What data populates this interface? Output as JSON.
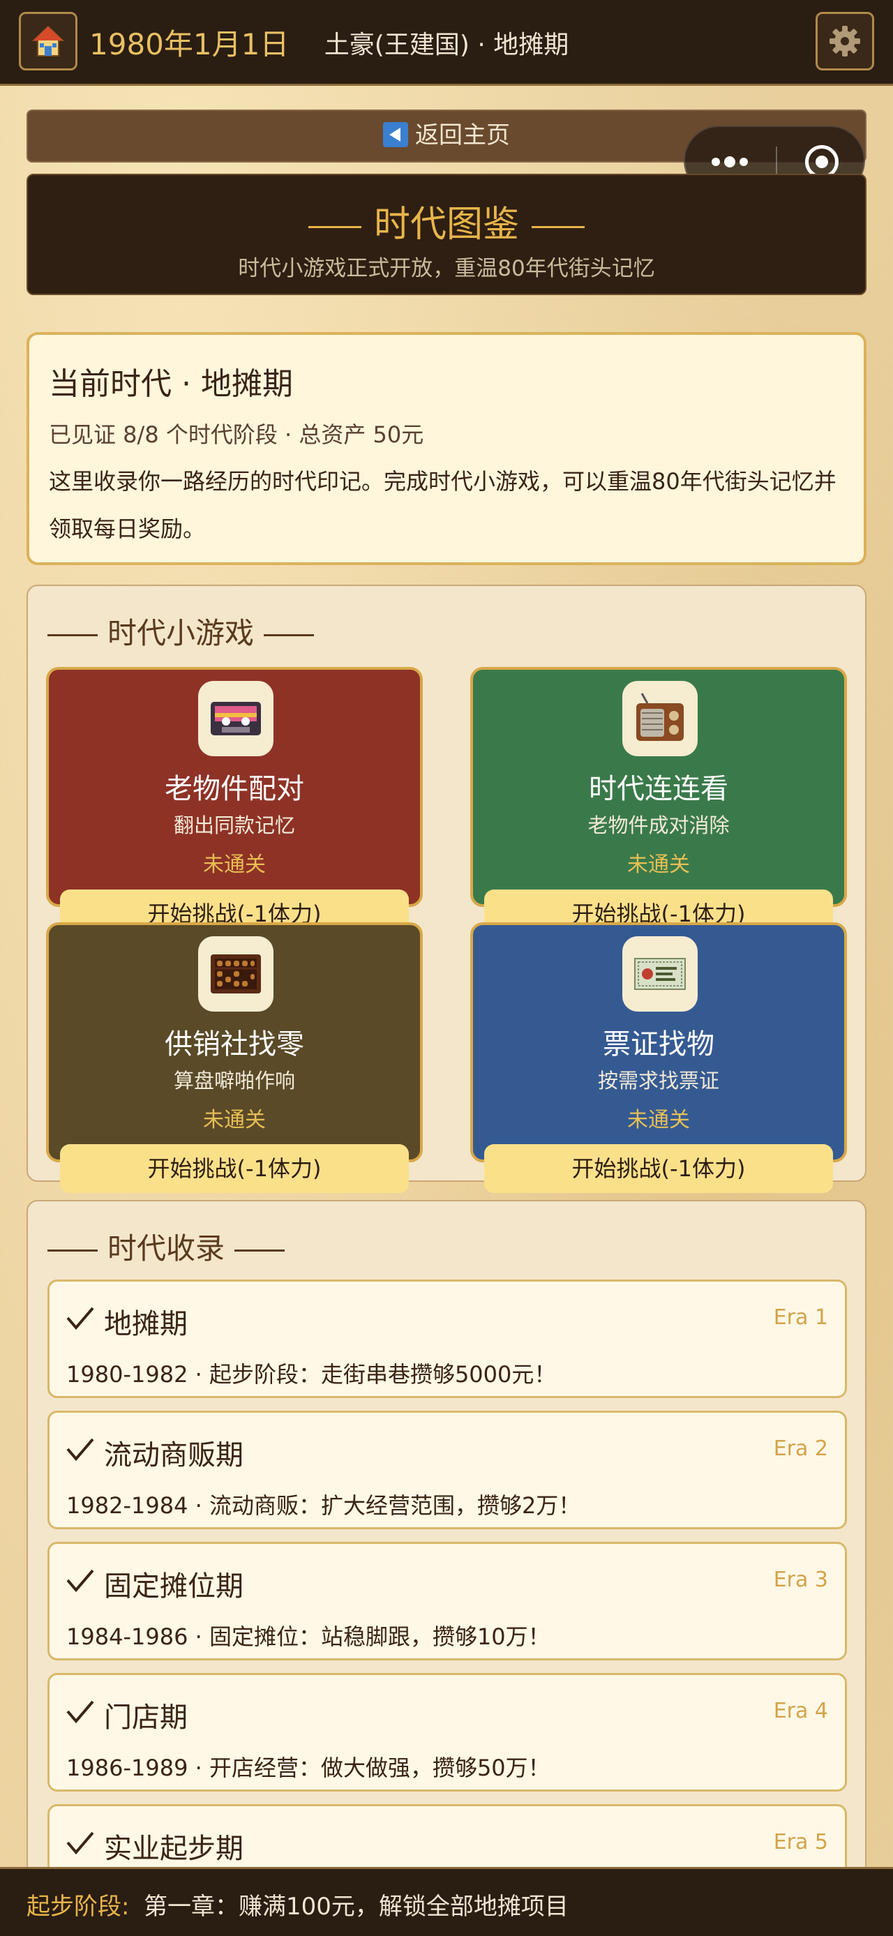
{
  "topbar": {
    "date": "1980年1月1日",
    "title": "土豪(王建国) · 地摊期"
  },
  "back": {
    "label": "返回主页"
  },
  "hero": {
    "title": "时代图鉴",
    "subtitle": "时代小游戏正式开放，重温80年代街头记忆"
  },
  "era_card": {
    "title": "当前时代 · 地摊期",
    "stats": "已见证 8/8 个时代阶段 · 总资产 50元",
    "description": "这里收录你一路经历的时代印记。完成时代小游戏，可以重温80年代街头记忆并领取每日奖励。"
  },
  "games_section": {
    "title": "时代小游戏",
    "games": [
      {
        "name": "老物件配对",
        "subtitle": "翻出同款记忆",
        "status": "未通关",
        "button": "开始挑战(-1体力)",
        "color": "#8e3226",
        "icon": "cassette-icon"
      },
      {
        "name": "时代连连看",
        "subtitle": "老物件成对消除",
        "status": "未通关",
        "button": "开始挑战(-1体力)",
        "color": "#3a7a4a",
        "icon": "radio-icon"
      },
      {
        "name": "供销社找零",
        "subtitle": "算盘噼啪作响",
        "status": "未通关",
        "button": "开始挑战(-1体力)",
        "color": "#5a4a28",
        "icon": "abacus-icon"
      },
      {
        "name": "票证找物",
        "subtitle": "按需求找票证",
        "status": "未通关",
        "button": "开始挑战(-1体力)",
        "color": "#355a92",
        "icon": "ration-ticket-icon"
      }
    ]
  },
  "records_section": {
    "title": "时代收录",
    "records": [
      {
        "name": "地摊期",
        "era": "Era 1",
        "desc": "1980-1982 · 起步阶段：走街串巷攒够5000元！"
      },
      {
        "name": "流动商贩期",
        "era": "Era 2",
        "desc": "1982-1984 · 流动商贩：扩大经营范围，攒够2万！"
      },
      {
        "name": "固定摊位期",
        "era": "Era 3",
        "desc": "1984-1986 · 固定摊位：站稳脚跟，攒够10万！"
      },
      {
        "name": "门店期",
        "era": "Era 4",
        "desc": "1986-1989 · 开店经营：做大做强，攒够50万！"
      },
      {
        "name": "实业起步期",
        "era": "Era 5",
        "desc": ""
      }
    ]
  },
  "bottom_bar": {
    "label": "起步阶段:",
    "text": "第一章：赚满100元，解锁全部地摊项目"
  },
  "colors": {
    "topbar_bg": "#2a1d12",
    "accent_gold": "#e8b54a",
    "button_yellow": "#fbe08a"
  }
}
